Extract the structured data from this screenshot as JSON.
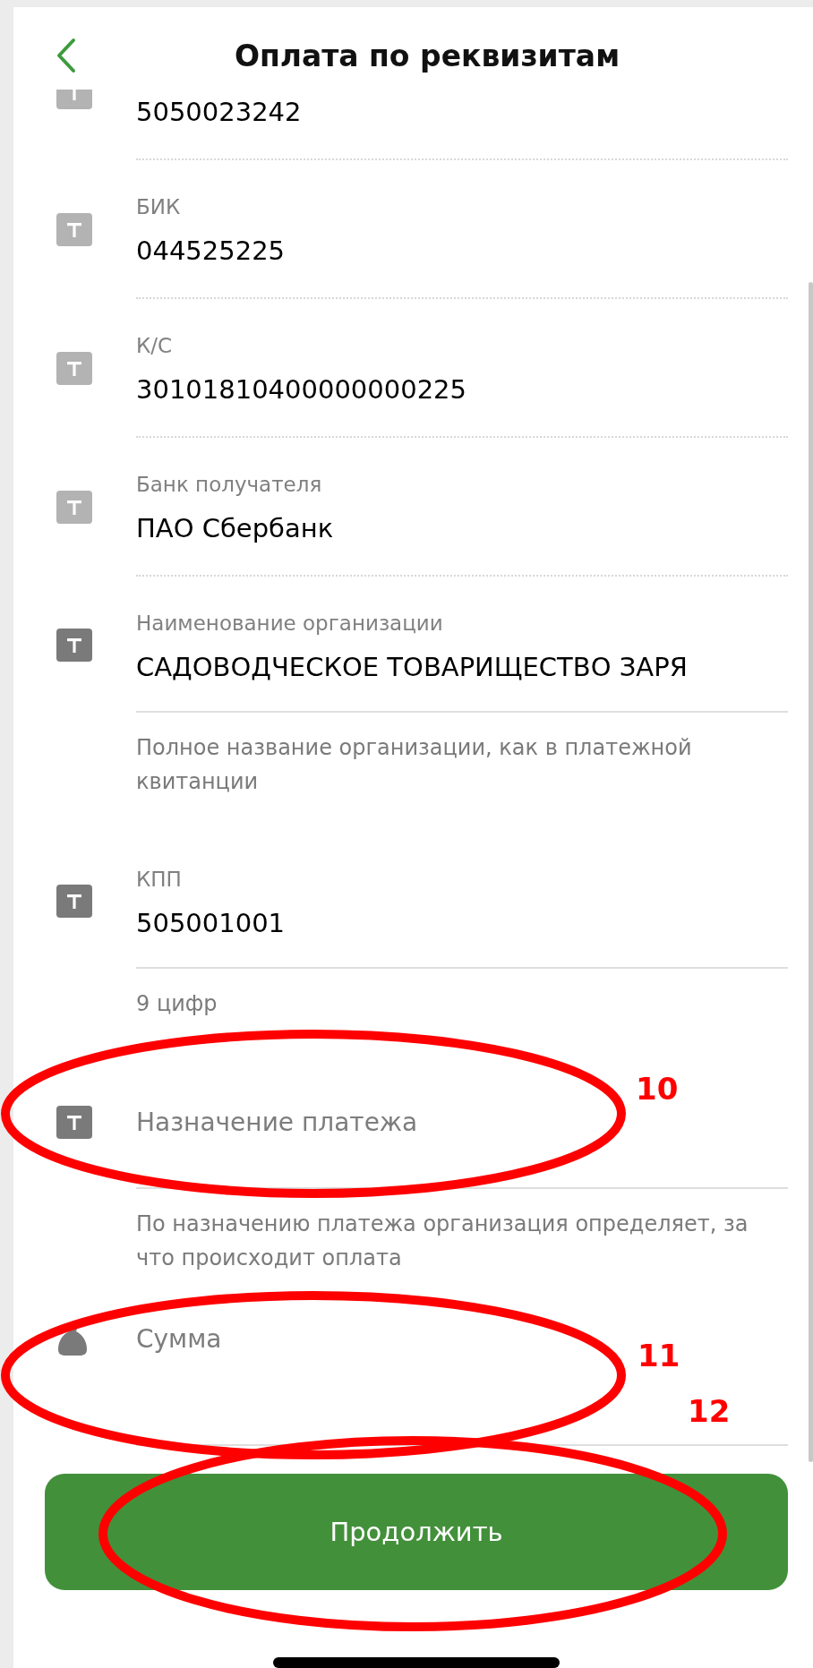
{
  "header": {
    "title": "Оплата по реквизитам"
  },
  "fields": [
    {
      "kind": "static",
      "value": "5050023242"
    },
    {
      "kind": "static",
      "label": "БИК",
      "value": "044525225"
    },
    {
      "kind": "static",
      "label": "К/С",
      "value": "30101810400000000225"
    },
    {
      "kind": "static",
      "label": "Банк получателя",
      "value": "ПАО Сбербанк"
    },
    {
      "kind": "text-input",
      "label": "Наименование организации",
      "value": "САДОВОДЧЕСКОЕ ТОВАРИЩЕСТВО ЗАРЯ",
      "hint": "Полное название организации, как в платежной квитанции"
    },
    {
      "kind": "text-input",
      "label": "КПП",
      "value": "505001001",
      "hint": "9 цифр"
    },
    {
      "kind": "text-input",
      "placeholder": "Назначение платежа",
      "hint": "По назначению платежа организация определяет, за что происходит оплата",
      "annotation": "10"
    },
    {
      "kind": "amount-input",
      "placeholder": "Сумма",
      "annotation": "11"
    }
  ],
  "button": {
    "label": "Продолжить",
    "annotation": "12"
  }
}
